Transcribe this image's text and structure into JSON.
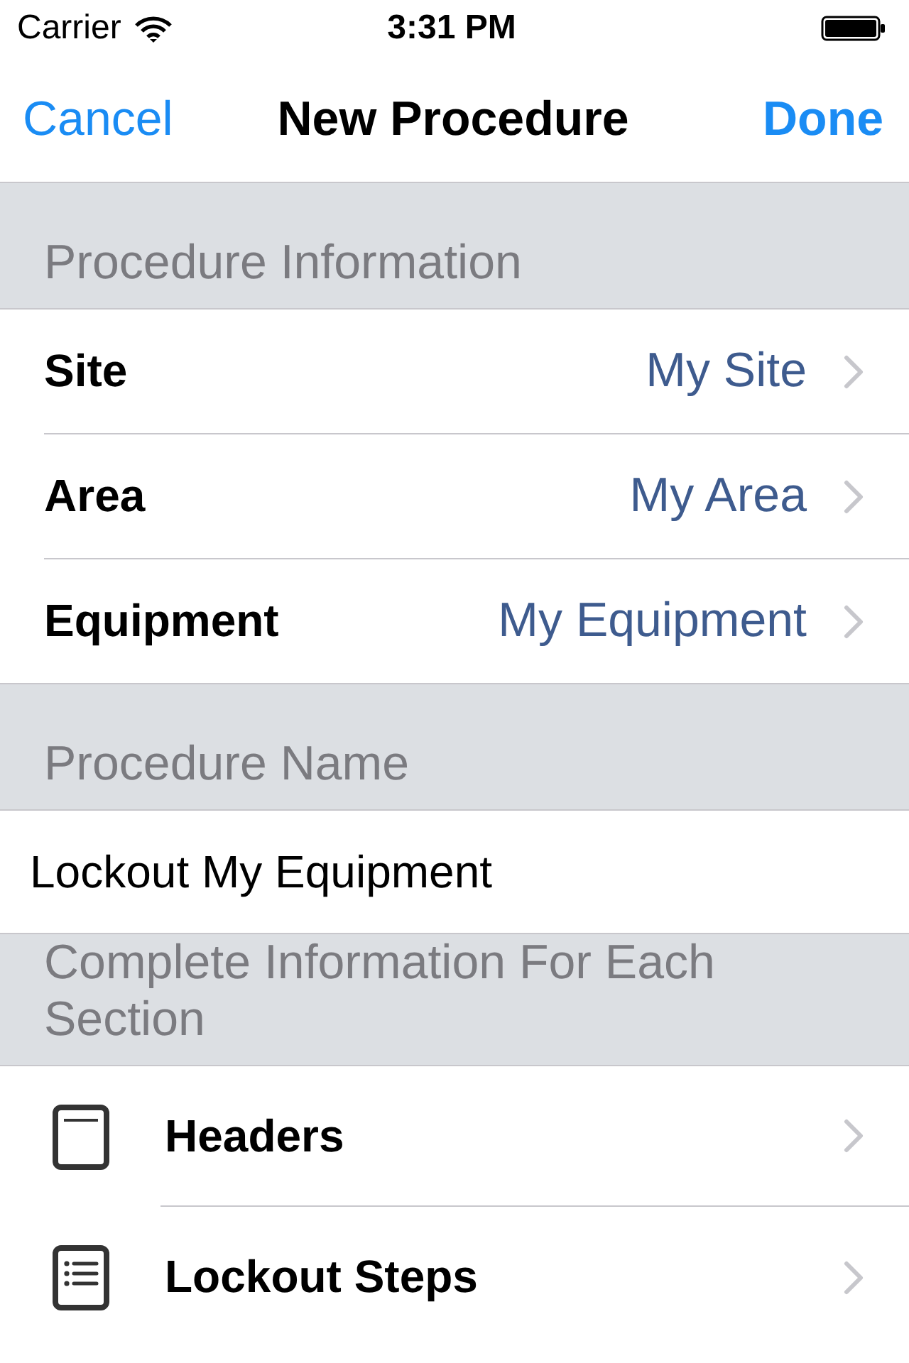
{
  "status_bar": {
    "carrier": "Carrier",
    "time": "3:31 PM"
  },
  "nav_bar": {
    "left_button": "Cancel",
    "title": "New Procedure",
    "right_button": "Done"
  },
  "sections": [
    {
      "kind": "detail",
      "header": "Procedure Information",
      "rows": [
        {
          "label": "Site",
          "value": "My Site"
        },
        {
          "label": "Area",
          "value": "My Area"
        },
        {
          "label": "Equipment",
          "value": "My Equipment"
        }
      ]
    },
    {
      "kind": "field",
      "header": "Procedure Name",
      "value": "Lockout My Equipment"
    },
    {
      "kind": "links",
      "header": "Complete Information For Each Section",
      "rows": [
        {
          "label": "Headers",
          "kind": "page"
        },
        {
          "label": "Lockout Steps",
          "kind": "checklist"
        }
      ]
    }
  ]
}
